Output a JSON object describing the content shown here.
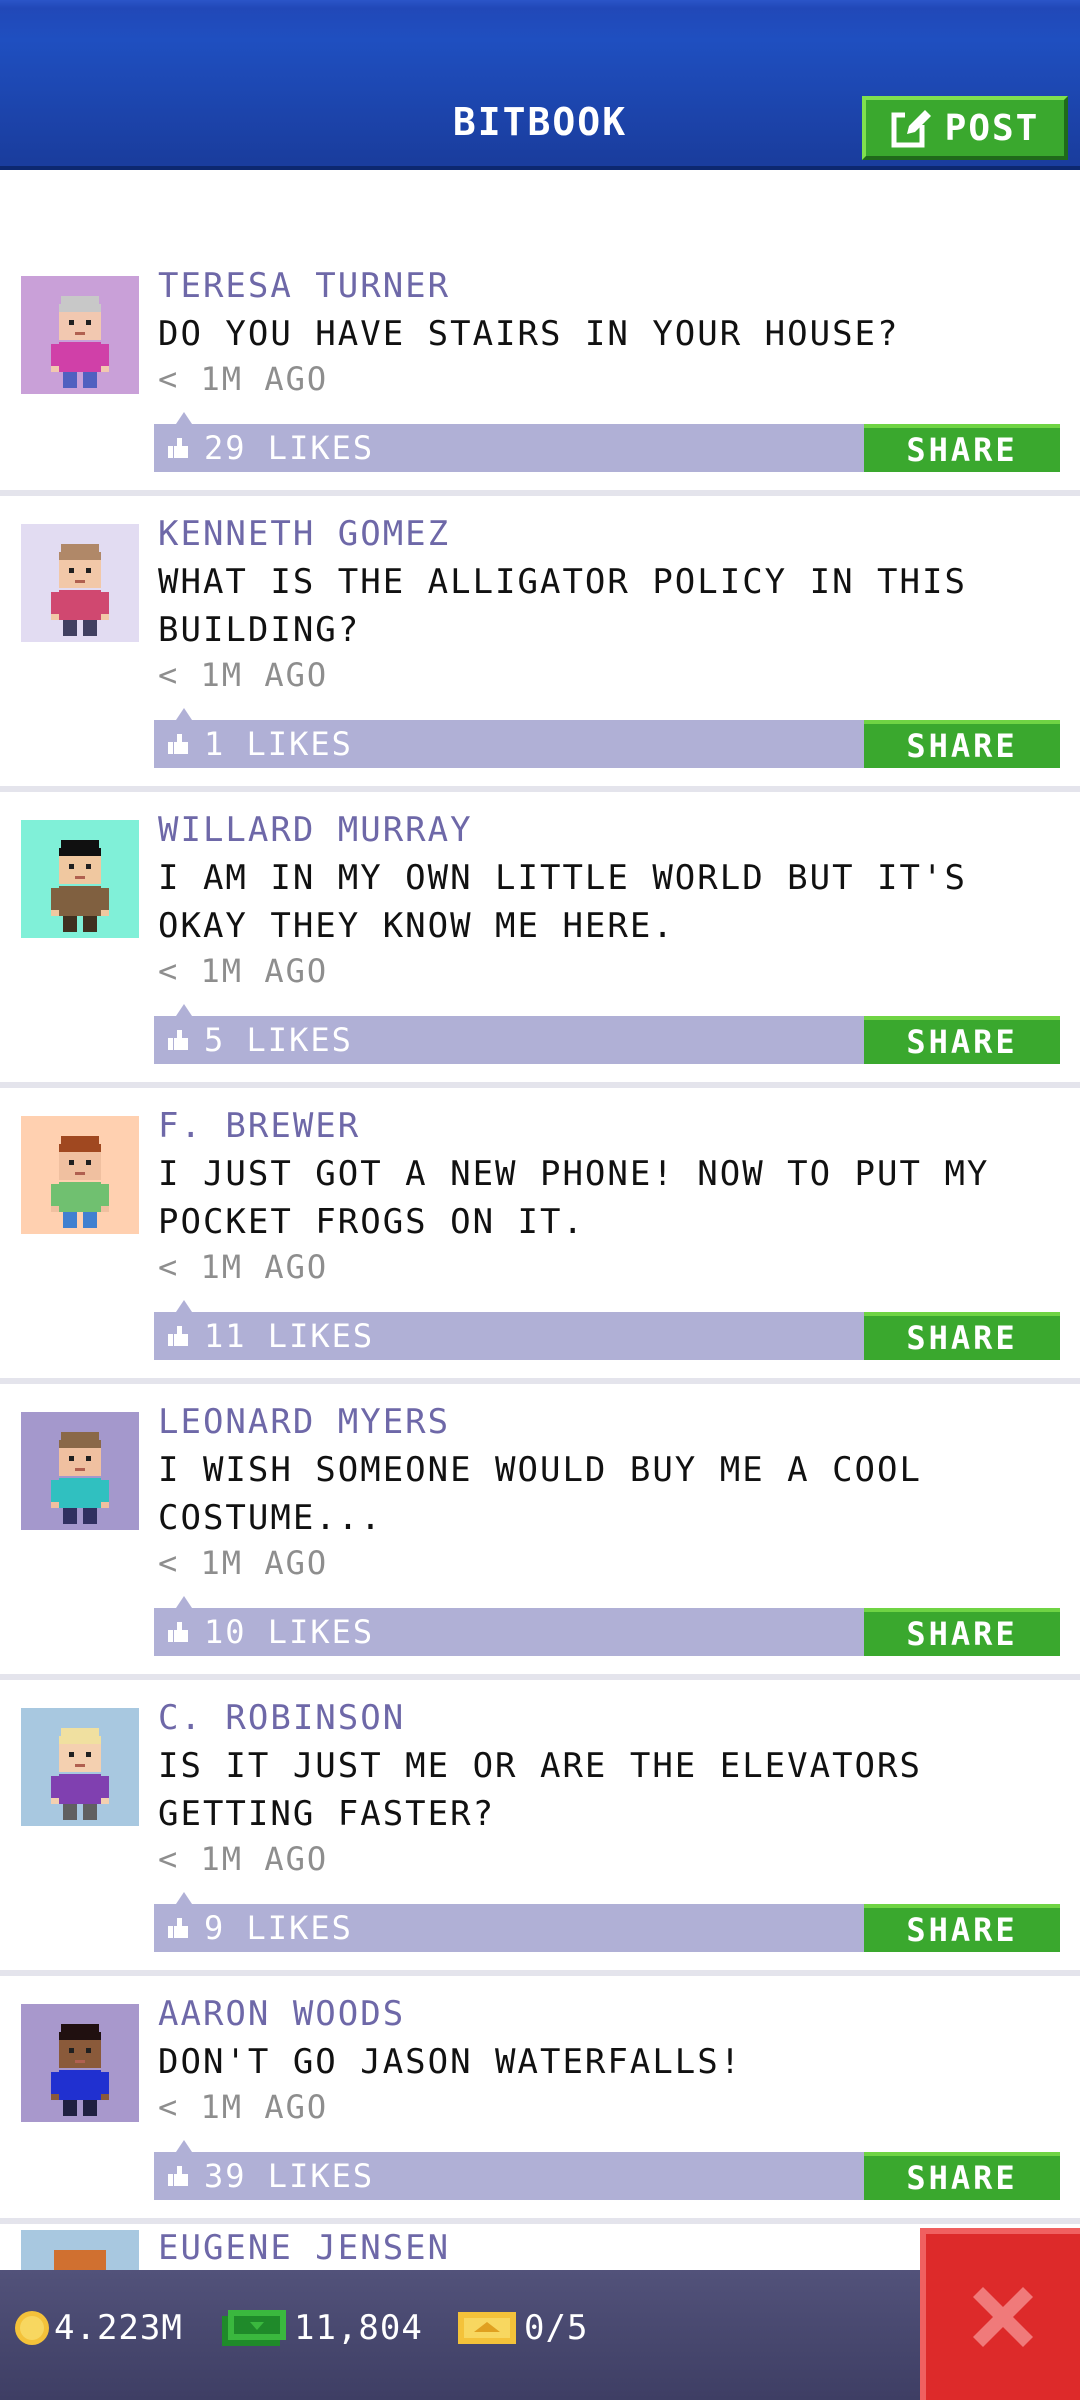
{
  "header": {
    "title": "BITBOOK",
    "post_label": "POST",
    "background_color": "#1f4fc0"
  },
  "posts": [
    {
      "author": "TERESA TURNER",
      "message": "DO YOU HAVE STAIRS IN YOUR HOUSE?",
      "time": "< 1M AGO",
      "likes": "29 LIKES",
      "share": "SHARE",
      "avatar_bg": "#c9a0d8",
      "skin": "#f2c8b0",
      "hair": "#c8c8c8",
      "shirt": "#d040a8",
      "pants": "#5060c0"
    },
    {
      "author": "KENNETH GOMEZ",
      "message": "WHAT IS THE ALLIGATOR POLICY IN THIS BUILDING?",
      "time": "< 1M AGO",
      "likes": "1 LIKES",
      "share": "SHARE",
      "avatar_bg": "#e2dcf2",
      "skin": "#f2c8a8",
      "hair": "#b08868",
      "shirt": "#d04870",
      "pants": "#404060"
    },
    {
      "author": "WILLARD MURRAY",
      "message": "I AM IN MY OWN LITTLE WORLD BUT IT'S OKAY THEY KNOW ME HERE.",
      "time": "< 1M AGO",
      "likes": "5 LIKES",
      "share": "SHARE",
      "avatar_bg": "#80f0d8",
      "skin": "#f0c8a0",
      "hair": "#101010",
      "shirt": "#806040",
      "pants": "#403020"
    },
    {
      "author": "F. BREWER",
      "message": "I JUST GOT A NEW PHONE! NOW TO PUT MY POCKET FROGS ON IT.",
      "time": "< 1M AGO",
      "likes": "11 LIKES",
      "share": "SHARE",
      "avatar_bg": "#ffd0b0",
      "skin": "#f0c0a0",
      "hair": "#a04820",
      "shirt": "#70c070",
      "pants": "#4080d0"
    },
    {
      "author": "LEONARD MYERS",
      "message": "I WISH SOMEONE WOULD BUY ME A COOL COSTUME...",
      "time": "< 1M AGO",
      "likes": "10 LIKES",
      "share": "SHARE",
      "avatar_bg": "#a498cc",
      "skin": "#f0c0a0",
      "hair": "#8a6848",
      "shirt": "#30c0c0",
      "pants": "#303060"
    },
    {
      "author": "C. ROBINSON",
      "message": "IS IT JUST ME OR ARE THE ELEVATORS GETTING FASTER?",
      "time": "< 1M AGO",
      "likes": "9 LIKES",
      "share": "SHARE",
      "avatar_bg": "#a8c8e0",
      "skin": "#f4d0b0",
      "hair": "#f0e0a0",
      "shirt": "#8040b0",
      "pants": "#606060"
    },
    {
      "author": "AARON WOODS",
      "message": "DON'T GO JASON WATERFALLS!",
      "time": "< 1M AGO",
      "likes": "39 LIKES",
      "share": "SHARE",
      "avatar_bg": "#a898cc",
      "skin": "#8a5a3a",
      "hair": "#201010",
      "shirt": "#2030d0",
      "pants": "#202040"
    }
  ],
  "partial_post": {
    "author": "EUGENE JENSEN",
    "avatar_bg": "#a8c8e0",
    "hair": "#d07030"
  },
  "status_bar": {
    "coins": "4.223M",
    "bux": "11,804",
    "tickets": "0/5"
  },
  "colors": {
    "accent_green": "#3aa82e",
    "likes_bar": "#b0b0d6",
    "name_text": "#6e68a8",
    "close_red": "#dd2a2a"
  }
}
